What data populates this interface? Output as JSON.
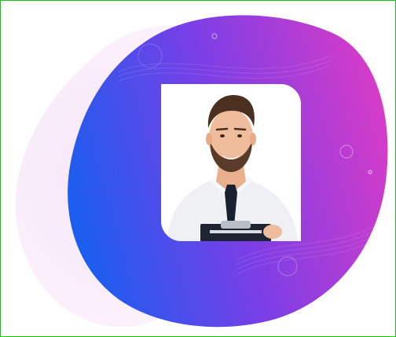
{
  "colors": {
    "frame_border": "#19c419",
    "blob_gradient_start": "#1a5ef0",
    "blob_gradient_mid": "#7b3ee6",
    "blob_gradient_end": "#d63cc8",
    "back_blob": "#fbeefb",
    "card_background": "#ffffff"
  },
  "hero_image": {
    "subject": "smiling-man-with-clipboard",
    "icon": "person-photo-icon"
  }
}
